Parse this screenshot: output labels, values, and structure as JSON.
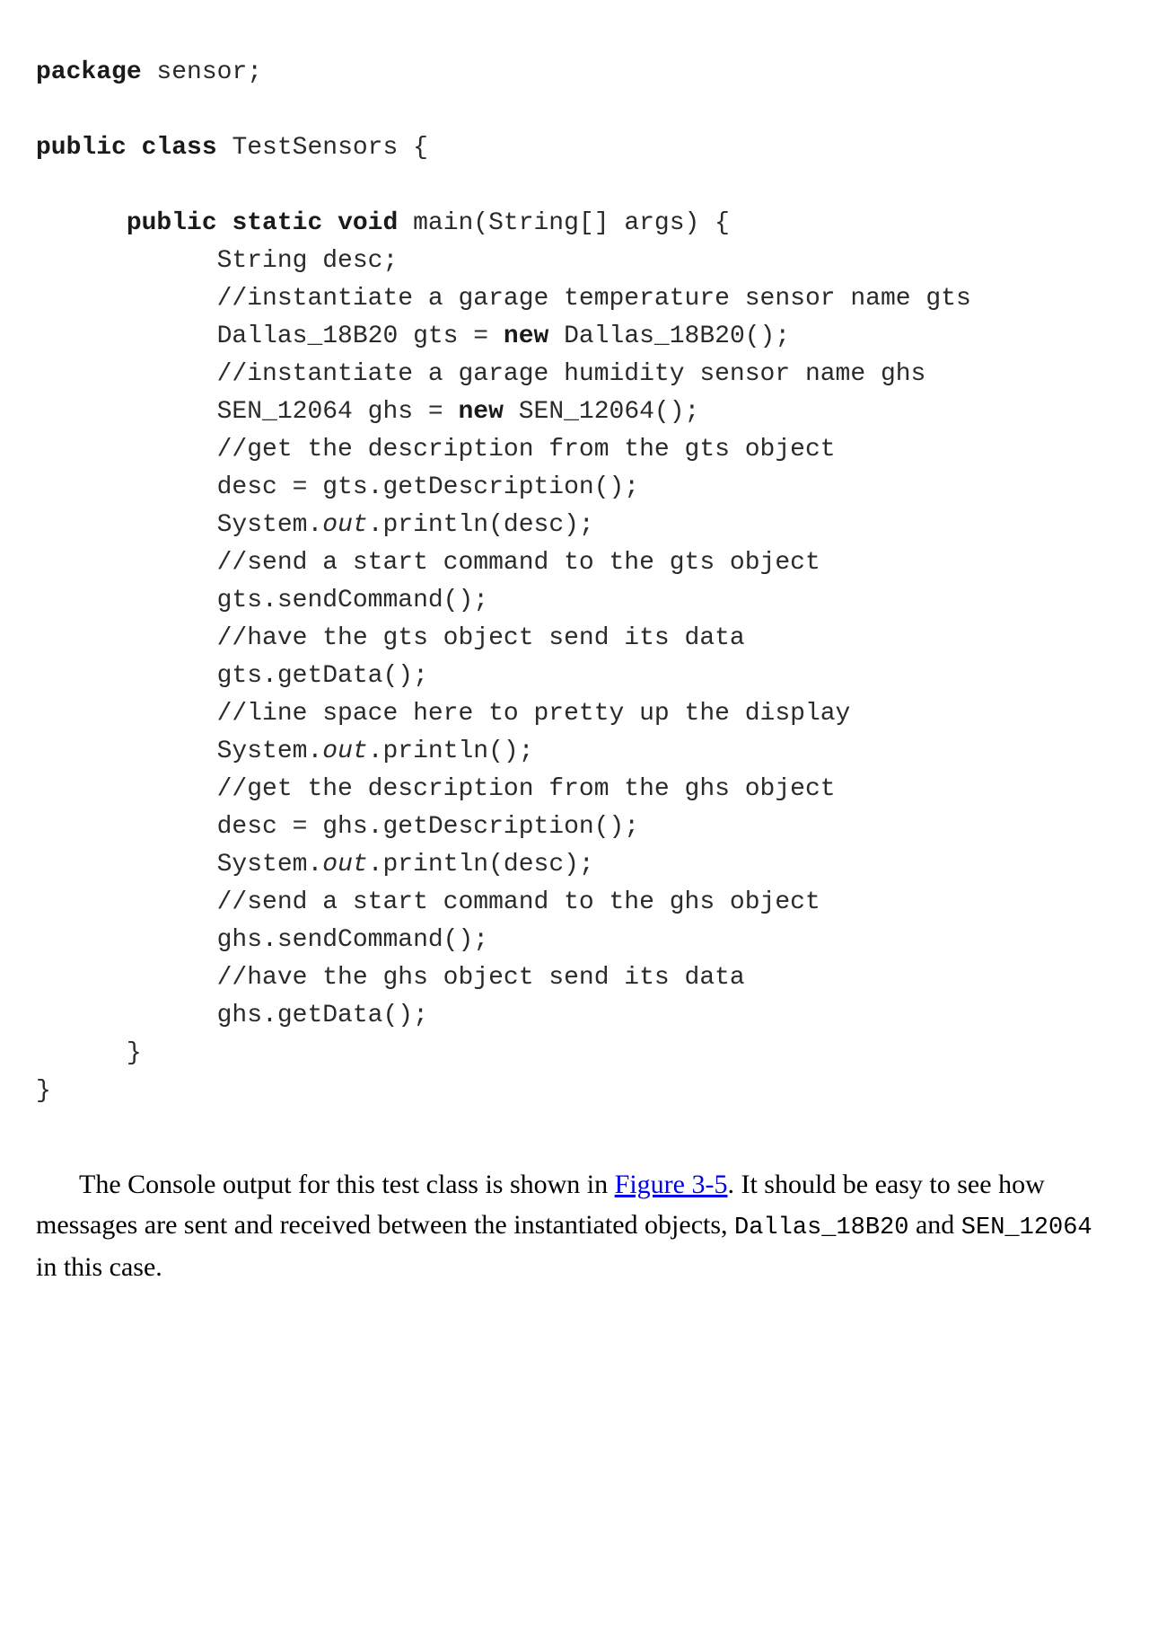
{
  "code": {
    "l1_kw1": "package",
    "l1_rest": " sensor;",
    "l2_kw1": "public class",
    "l2_rest": " TestSensors {",
    "l3_ind": "      ",
    "l3_kw1": "public static void",
    "l3_rest": " main(String[] args) {",
    "l4": "            String desc;",
    "l5": "            //instantiate a garage temperature sensor name gts",
    "l6_a": "            Dallas_18B20 gts = ",
    "l6_kw": "new",
    "l6_b": " Dallas_18B20();",
    "l7": "            //instantiate a garage humidity sensor name ghs",
    "l8_a": "            SEN_12064 ghs = ",
    "l8_kw": "new",
    "l8_b": " SEN_12064();",
    "l9": "            //get the description from the gts object",
    "l10": "            desc = gts.getDescription();",
    "l11_a": "            System.",
    "l11_it": "out",
    "l11_b": ".println(desc);",
    "l12": "            //send a start command to the gts object",
    "l13": "            gts.sendCommand();",
    "l14": "            //have the gts object send its data",
    "l15": "            gts.getData();",
    "l16": "            //line space here to pretty up the display",
    "l17_a": "            System.",
    "l17_it": "out",
    "l17_b": ".println();",
    "l18": "            //get the description from the ghs object",
    "l19": "            desc = ghs.getDescription();",
    "l20_a": "            System.",
    "l20_it": "out",
    "l20_b": ".println(desc);",
    "l21": "            //send a start command to the ghs object",
    "l22": "            ghs.sendCommand();",
    "l23": "            //have the ghs object send its data",
    "l24": "            ghs.getData();",
    "l25": "      }",
    "l26": "}"
  },
  "paragraph": {
    "t1": "The Console output for this test class is shown in ",
    "link": "Figure 3-5",
    "t2": ". It should be easy to see how messages are sent and received between the instantiated objects, ",
    "mono1": "Dallas_18B20",
    "t3": " and ",
    "mono2": "SEN_12064",
    "t4": " in this case."
  }
}
